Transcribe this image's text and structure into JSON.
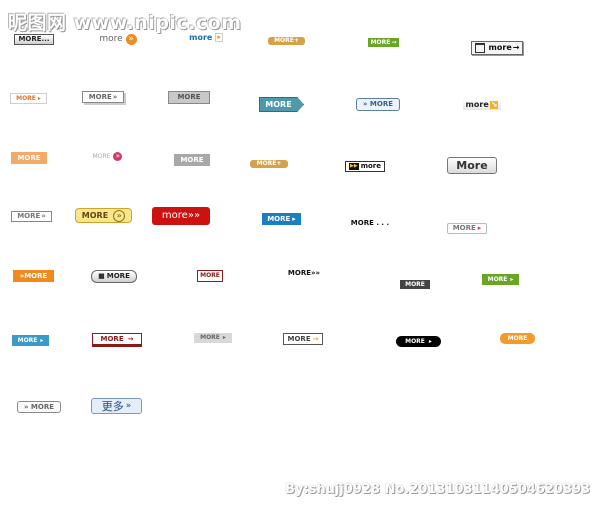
{
  "watermark": {
    "site_text": "昵图网 www.nipic.com"
  },
  "credit": {
    "text": "By:shujj0928  No.20131031140504620393"
  },
  "buttons": {
    "b1": "MORE...",
    "b2": "more",
    "b2_icon": "»",
    "b3": "more",
    "b3_icon": "▸",
    "b4": "MORE+",
    "b5": "MORE",
    "b5_icon": "→",
    "b6": "more",
    "b6_icon": "→",
    "b7": "MORE",
    "b7_icon": "▸",
    "b8": "MORE",
    "b8_icon": "»",
    "b9": "MORE",
    "b10": "MORE",
    "b11": "» MORE",
    "b12": "more",
    "b12_icon": "↘",
    "b13": "MORE",
    "b14": "MORE",
    "b14_icon": "»",
    "b15": "MORE",
    "b16": "MORE+",
    "b17": "more",
    "b17_icon": "▶▶",
    "b18": "More",
    "b19": "MORE",
    "b19_icon": "»",
    "b20": "MORE",
    "b20_icon": "»",
    "b21": "more»»",
    "b22": "MORE",
    "b22_icon": "▸",
    "b23": "MORE . . .",
    "b24": "MORE",
    "b24_icon": "▸",
    "b25": "»MORE",
    "b26": "MORE",
    "b26_icon": "■",
    "b27": "MORE",
    "b28": "MORE»»",
    "b29": "MORE",
    "b30": "MORE",
    "b30_icon": "▸",
    "b31": "MORE",
    "b31_icon": "▸",
    "b32": "MORE",
    "b32_icon": "→",
    "b33": "MORE",
    "b33_icon": "▸",
    "b34": "MORE",
    "b34_icon": "→",
    "b35": "MORE",
    "b35_icon": "▸",
    "b36": "MORE",
    "b37": "» MORE",
    "b38": "更多",
    "b38_icon": "»"
  },
  "colors": {
    "orange": "#f08a1e",
    "green": "#6aa527",
    "blue": "#1a7fc1",
    "teal": "#4e9aaa",
    "red": "#cc1111",
    "dark_red": "#8a1a1a",
    "gray": "#a8a8a8",
    "black": "#000000",
    "yellow": "#fce58a"
  }
}
